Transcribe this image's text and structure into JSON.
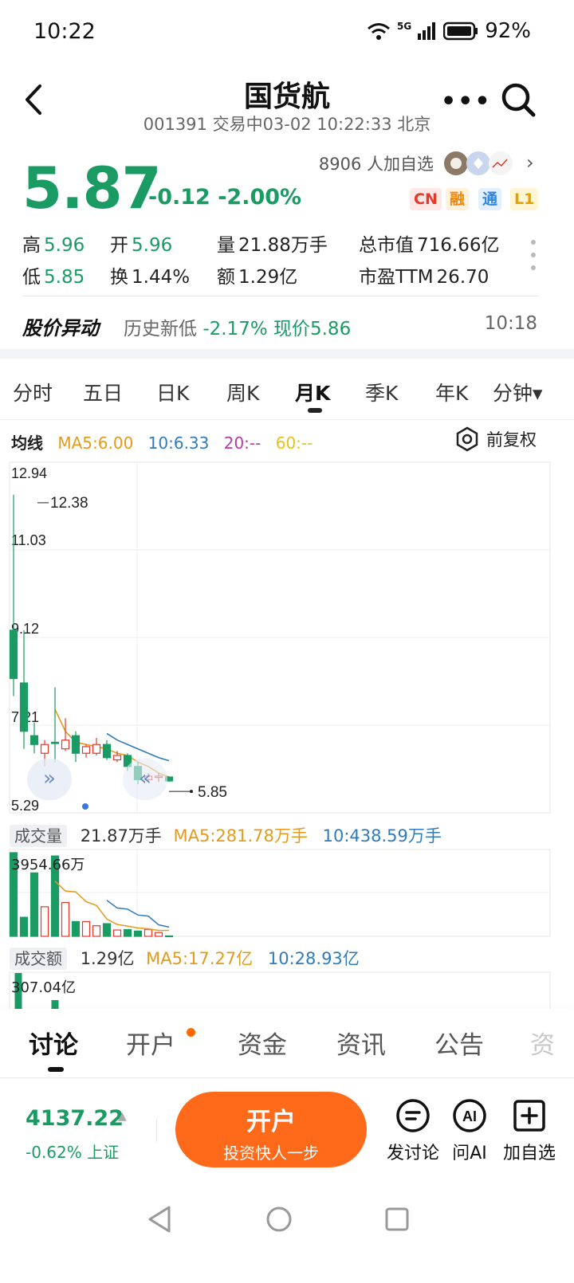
{
  "status": {
    "time": "10:22",
    "network": "5G",
    "battery": "92%"
  },
  "header": {
    "title": "国货航",
    "subtitle": "001391 交易中03-02 10:22:33 北京"
  },
  "quote": {
    "price": "5.87",
    "change": "-0.12 -2.00%",
    "followers": "8906 人加自选",
    "badges": [
      "CN",
      "融",
      "通",
      "L1"
    ],
    "stats": {
      "high_label": "高",
      "high": "5.96",
      "open_label": "开",
      "open": "5.96",
      "volume_label": "量",
      "volume": "21.88万手",
      "mktcap_label": "总市值",
      "mktcap": "716.66亿",
      "low_label": "低",
      "low": "5.85",
      "turnover_label": "换",
      "turnover": "1.44%",
      "amount_label": "额",
      "amount": "1.29亿",
      "pe_label": "市盈TTM",
      "pe": "26.70"
    }
  },
  "alert": {
    "label": "股价异动",
    "text_prefix": "历史新低",
    "text_value": "-2.17% 现价5.86",
    "time": "10:18"
  },
  "chart_tabs": [
    "分时",
    "五日",
    "日K",
    "周K",
    "月K",
    "季K",
    "年K",
    "分钟▾"
  ],
  "ma_row": {
    "label": "均线",
    "ma5": "MA5:6.00",
    "ma10": "10:6.33",
    "ma20": "20:--",
    "ma60": "60:--",
    "fq": "前复权",
    "colors": {
      "ma5": "#e59a1c",
      "ma10": "#2f7bbd",
      "ma20": "#b63ca5",
      "ma60": "#e5c21b"
    }
  },
  "chart_data": [
    {
      "type": "candlestick",
      "title": "",
      "period": "月K",
      "y_ticks": [
        "12.94",
        "11.03",
        "9.12",
        "7.21",
        "5.29"
      ],
      "ylim": [
        5.29,
        12.94
      ],
      "annotations": {
        "max_label": "12.38",
        "last_label": "5.85"
      },
      "grid": true,
      "candles": [
        {
          "open": 9.3,
          "close": 8.2,
          "high": 12.38,
          "low": 7.8
        },
        {
          "open": 8.1,
          "close": 7.0,
          "high": 9.3,
          "low": 6.6
        },
        {
          "open": 6.9,
          "close": 6.7,
          "high": 7.2,
          "low": 6.5
        },
        {
          "open": 6.5,
          "close": 6.7,
          "high": 6.8,
          "low": 6.2
        },
        {
          "open": 6.75,
          "close": 6.75,
          "high": 8.0,
          "low": 6.3
        },
        {
          "open": 6.6,
          "close": 6.8,
          "high": 7.3,
          "low": 6.55
        },
        {
          "open": 6.9,
          "close": 6.5,
          "high": 7.0,
          "low": 6.3
        },
        {
          "open": 6.5,
          "close": 6.65,
          "high": 6.7,
          "low": 6.4
        },
        {
          "open": 6.5,
          "close": 6.7,
          "high": 6.85,
          "low": 6.45
        },
        {
          "open": 6.7,
          "close": 6.4,
          "high": 6.8,
          "low": 6.35
        },
        {
          "open": 6.35,
          "close": 6.45,
          "high": 6.55,
          "low": 6.3
        },
        {
          "open": 6.45,
          "close": 6.2,
          "high": 6.5,
          "low": 6.1
        },
        {
          "open": 6.2,
          "close": 5.9,
          "high": 6.3,
          "low": 5.8
        },
        {
          "open": 5.9,
          "close": 5.98,
          "high": 6.05,
          "low": 5.85
        },
        {
          "open": 5.95,
          "close": 5.98,
          "high": 6.05,
          "low": 5.85
        },
        {
          "open": 5.96,
          "close": 5.87,
          "high": 5.96,
          "low": 5.85
        }
      ],
      "ma5": [
        null,
        null,
        null,
        null,
        7.5,
        7.0,
        6.75,
        6.7,
        6.65,
        6.6,
        6.5,
        6.45,
        6.3,
        6.2,
        6.05,
        5.96
      ],
      "ma10": [
        null,
        null,
        null,
        null,
        null,
        null,
        null,
        null,
        null,
        6.95,
        6.8,
        6.7,
        6.6,
        6.5,
        6.4,
        6.33
      ]
    },
    {
      "type": "bar",
      "title": "成交量",
      "summary": {
        "value": "21.87万手",
        "ma5": "MA5:281.78万手",
        "ma10": "10:438.59万手"
      },
      "max_label": "3954.66万",
      "unit": "万手",
      "values": [
        3954.66,
        900,
        3000,
        1400,
        3800,
        1600,
        700,
        700,
        500,
        600,
        300,
        320,
        250,
        330,
        180,
        21.87
      ],
      "ma5": [
        null,
        null,
        null,
        null,
        2611,
        2140,
        2100,
        1640,
        1460,
        820,
        560,
        484,
        394,
        360,
        276,
        281.78
      ],
      "ma10": [
        null,
        null,
        null,
        null,
        null,
        null,
        null,
        null,
        null,
        1705,
        1340,
        1285,
        1010,
        955,
        545,
        438.59
      ]
    },
    {
      "type": "bar",
      "title": "成交额",
      "summary": {
        "value": "1.29亿",
        "ma5": "MA5:17.27亿",
        "ma10": "10:28.93亿"
      },
      "max_label": "307.04亿",
      "unit": "亿"
    }
  ],
  "bottom_tabs": [
    "讨论",
    "开户",
    "资金",
    "资讯",
    "公告",
    "资"
  ],
  "index": {
    "value": "4137.22",
    "change": "-0.62% 上证"
  },
  "open_account": {
    "title": "开户",
    "subtitle": "投资快人一步"
  },
  "actions": {
    "discuss": "发讨论",
    "ai": "问AI",
    "add": "加自选"
  }
}
